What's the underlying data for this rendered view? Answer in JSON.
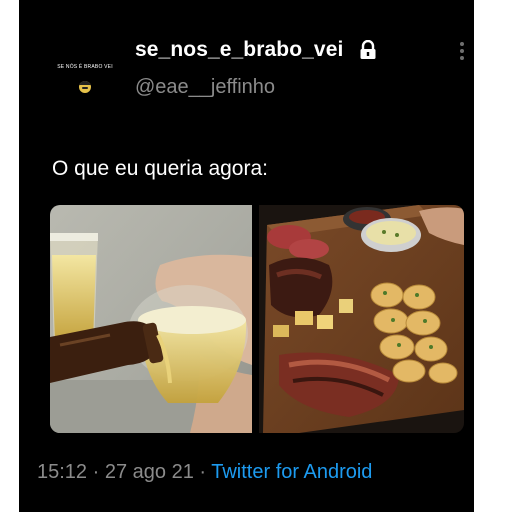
{
  "tweet": {
    "avatar_caption": "SE NÓS É BRABO VEI",
    "display_name": "se_nos_e_brabo_vei",
    "handle": "@eae__jeffinho",
    "text": "O que eu queria agora:",
    "time": "15:12",
    "separator": " · ",
    "date": "27 ago 21",
    "source": "Twitter for Android"
  },
  "icons": {
    "lock": "lock-icon",
    "more": "more-options-icon",
    "avatar": "avatar-emoji-icon"
  },
  "colors": {
    "background": "#000000",
    "text": "#ffffff",
    "muted": "#8b8b8b",
    "link": "#1d9bf0"
  },
  "media": [
    {
      "description_name": "beer-pouring-photo"
    },
    {
      "description_name": "steak-board-photo"
    }
  ]
}
